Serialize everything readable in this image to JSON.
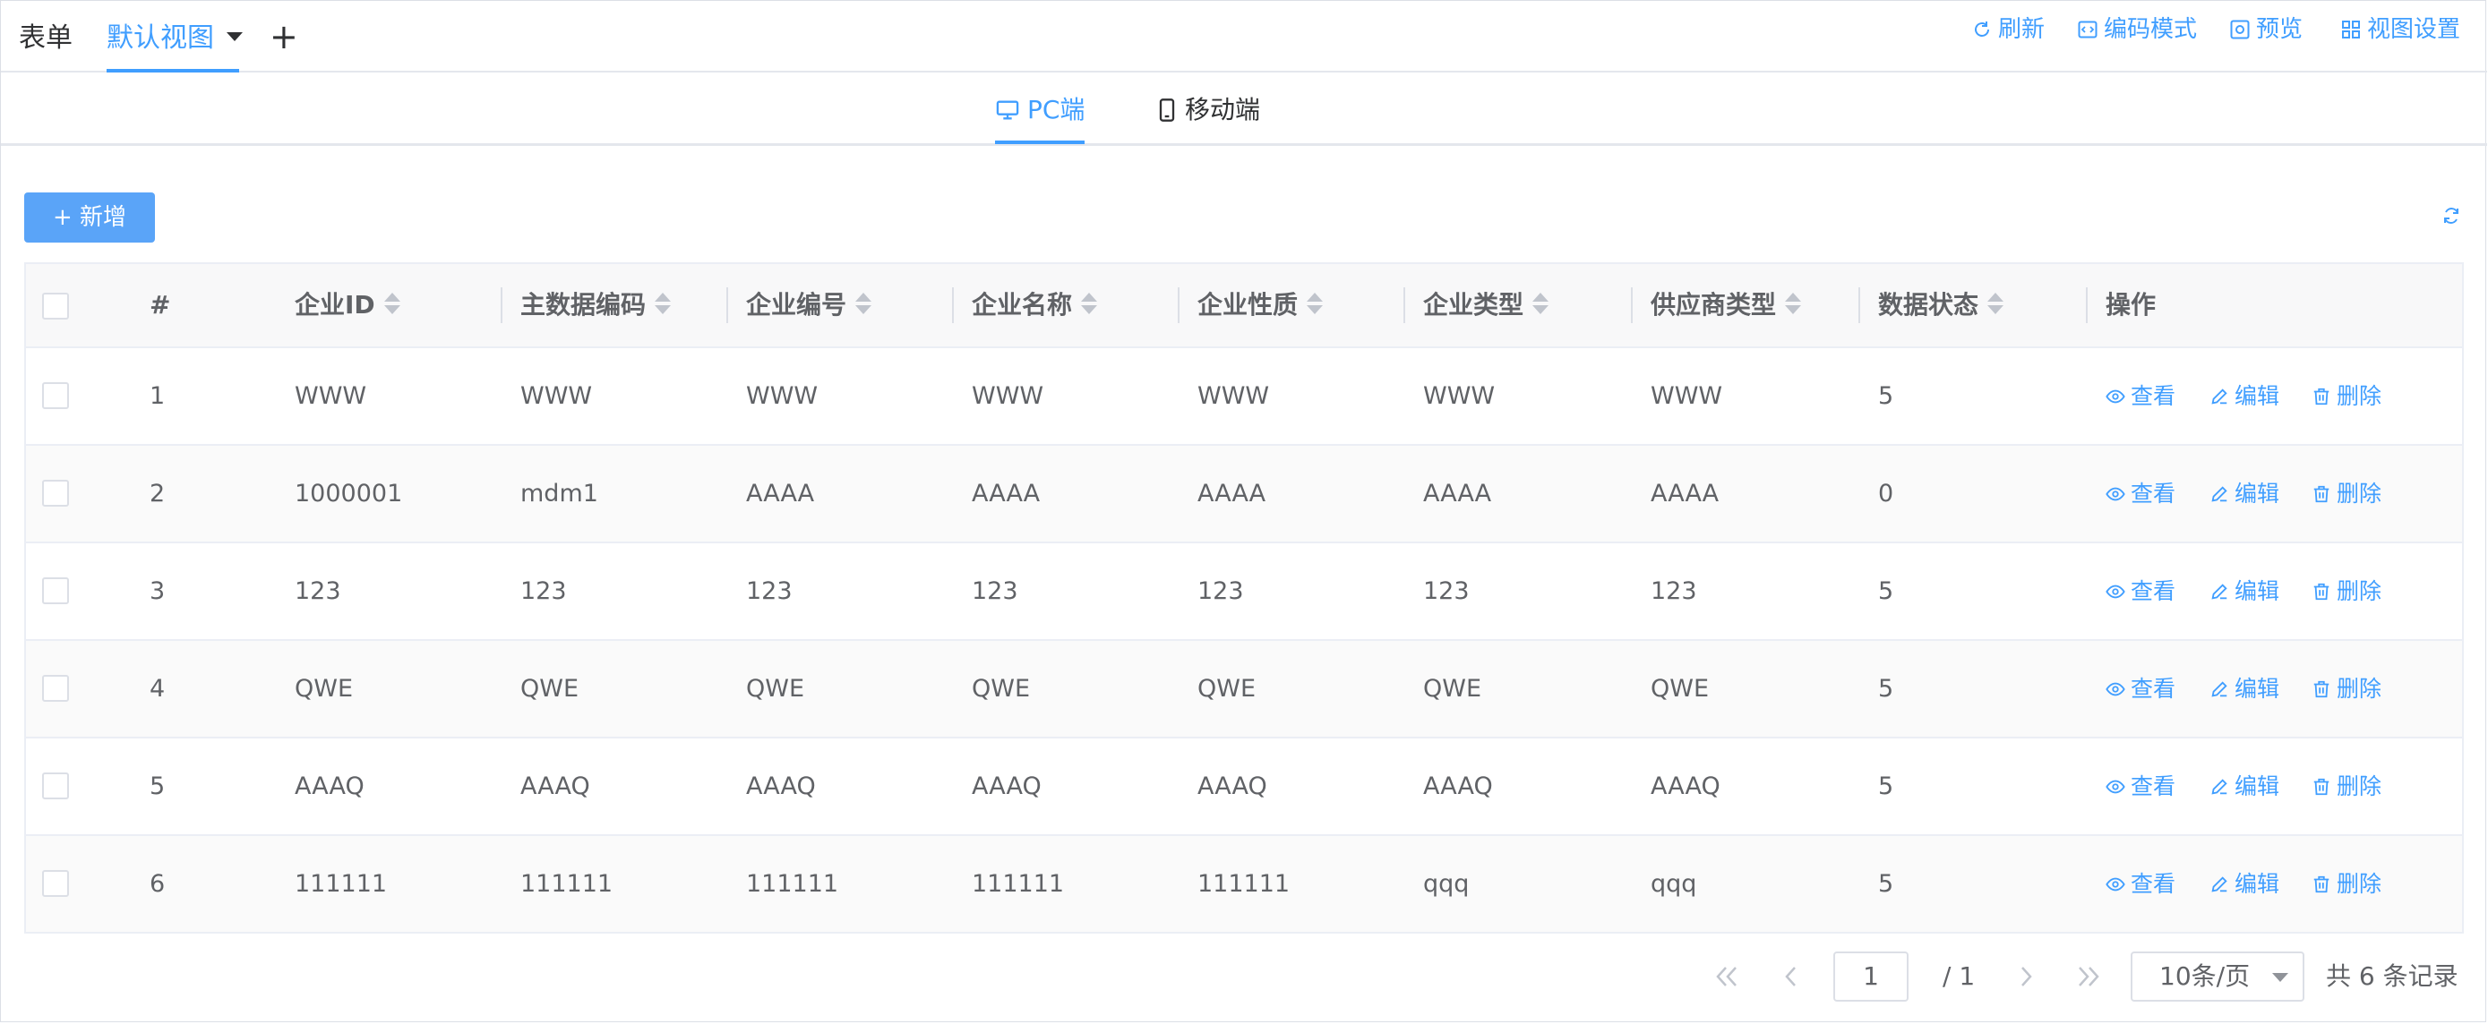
{
  "top_tabs": {
    "form": "表单",
    "view": "默认视图",
    "add": "+"
  },
  "toolbar": {
    "refresh": "刷新",
    "code_mode": "编码模式",
    "preview": "预览",
    "view_settings": "视图设置"
  },
  "device_tabs": {
    "pc": "PC端",
    "mobile": "移动端"
  },
  "actions_bar": {
    "add_label": "+ 新增"
  },
  "table": {
    "headers": [
      "#",
      "企业ID",
      "主数据编码",
      "企业编号",
      "企业名称",
      "企业性质",
      "企业类型",
      "供应商类型",
      "数据状态",
      "操作"
    ],
    "rows": [
      [
        "1",
        "WWW",
        "WWW",
        "WWW",
        "WWW",
        "WWW",
        "WWW",
        "WWW",
        "5"
      ],
      [
        "2",
        "1000001",
        "mdm1",
        "AAAA",
        "AAAA",
        "AAAA",
        "AAAA",
        "AAAA",
        "0"
      ],
      [
        "3",
        "123",
        "123",
        "123",
        "123",
        "123",
        "123",
        "123",
        "5"
      ],
      [
        "4",
        "QWE",
        "QWE",
        "QWE",
        "QWE",
        "QWE",
        "QWE",
        "QWE",
        "5"
      ],
      [
        "5",
        "AAAQ",
        "AAAQ",
        "AAAQ",
        "AAAQ",
        "AAAQ",
        "AAAQ",
        "AAAQ",
        "5"
      ],
      [
        "6",
        "111111",
        "111111",
        "111111",
        "111111",
        "111111",
        "qqq",
        "qqq",
        "5"
      ]
    ],
    "row_actions": {
      "view": "查看",
      "edit": "编辑",
      "delete": "删除"
    }
  },
  "pagination": {
    "current_page": "1",
    "total_pages": "/ 1",
    "page_size": "10条/页",
    "total": "共 6 条记录"
  },
  "colors": {
    "accent": "#409eff",
    "button": "#5aa4f8",
    "border": "#ebeef5"
  }
}
